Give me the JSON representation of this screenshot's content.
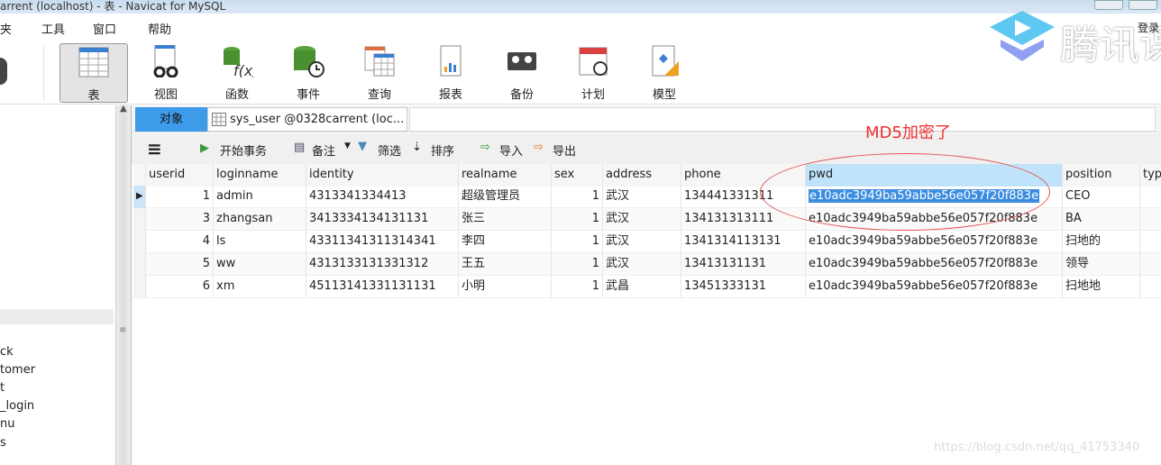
{
  "window": {
    "title": "arrent (localhost) - 表 - Navicat for MySQL"
  },
  "menu": [
    "夹",
    "工具",
    "窗口",
    "帮助"
  ],
  "toolbar": [
    {
      "label": "表",
      "icon": "table-icon"
    },
    {
      "label": "视图",
      "icon": "view-icon"
    },
    {
      "label": "函数",
      "icon": "function-icon"
    },
    {
      "label": "事件",
      "icon": "event-icon"
    },
    {
      "label": "查询",
      "icon": "query-icon"
    },
    {
      "label": "报表",
      "icon": "report-icon"
    },
    {
      "label": "备份",
      "icon": "backup-icon"
    },
    {
      "label": "计划",
      "icon": "schedule-icon"
    },
    {
      "label": "模型",
      "icon": "model-icon"
    }
  ],
  "sidebar": {
    "items": [
      "ck",
      "tomer",
      "t",
      "_login",
      "nu",
      "s"
    ]
  },
  "tabs": {
    "objects": "对象",
    "table_tab": "sys_user @0328carrent (loc..."
  },
  "data_toolbar": {
    "begin_transaction": "开始事务",
    "memo": "备注",
    "filter": "筛选",
    "sort": "排序",
    "import": "导入",
    "export": "导出"
  },
  "grid": {
    "columns": [
      "userid",
      "loginname",
      "identity",
      "realname",
      "sex",
      "address",
      "phone",
      "pwd",
      "position",
      "typ"
    ],
    "rows": [
      [
        "1",
        "admin",
        "4313341334413",
        "超级管理员",
        "1",
        "武汉",
        "134441331311",
        "e10adc3949ba59abbe56e057f20f883e",
        "CEO"
      ],
      [
        "3",
        "zhangsan",
        "3413334134131131",
        "张三",
        "1",
        "武汉",
        "134131313111",
        "e10adc3949ba59abbe56e057f20f883e",
        "BA"
      ],
      [
        "4",
        "ls",
        "43311341311314341",
        "李四",
        "1",
        "武汉",
        "1341314113131",
        "e10adc3949ba59abbe56e057f20f883e",
        "扫地的"
      ],
      [
        "5",
        "ww",
        "4313133131331312",
        "王五",
        "1",
        "武汉",
        "13413131131",
        "e10adc3949ba59abbe56e057f20f883e",
        "领导"
      ],
      [
        "6",
        "xm",
        "45113141331131131",
        "小明",
        "1",
        "武昌",
        "13451333131",
        "e10adc3949ba59abbe56e057f20f883e",
        "扫地地"
      ]
    ],
    "selected_row": 0,
    "selected_column": "pwd"
  },
  "annotation": "MD5加密了",
  "overlay": {
    "logo_text": "腾讯课",
    "login": "登录",
    "watermark": "https://blog.csdn.net/qq_41753340"
  },
  "colors": {
    "tab_active": "#3d9be9",
    "selection": "#3c8de0",
    "annotation": "#f03030"
  }
}
